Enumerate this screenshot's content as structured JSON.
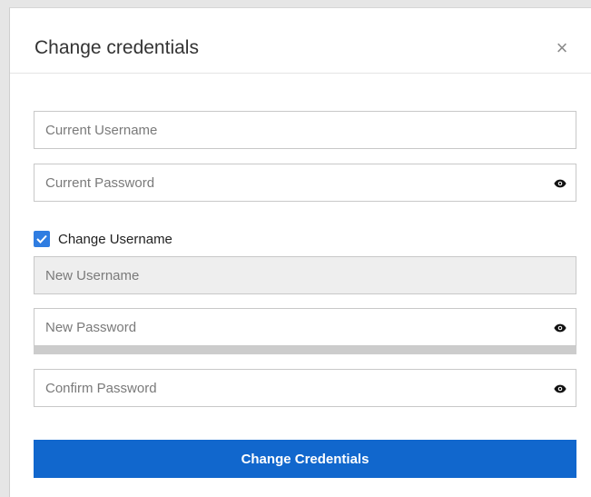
{
  "dialog": {
    "title": "Change credentials",
    "close_label": "×"
  },
  "fields": {
    "current_username": {
      "placeholder": "Current Username",
      "value": ""
    },
    "current_password": {
      "placeholder": "Current Password",
      "value": ""
    },
    "new_username": {
      "placeholder": "New Username",
      "value": "",
      "disabled": true
    },
    "new_password": {
      "placeholder": "New Password",
      "value": ""
    },
    "confirm_password": {
      "placeholder": "Confirm Password",
      "value": ""
    }
  },
  "change_username": {
    "label": "Change Username",
    "checked": true
  },
  "icons": {
    "password_toggle": "eye-icon",
    "checkbox": "checkmark-icon",
    "close": "close-icon"
  },
  "colors": {
    "primary_button": "#1167cd",
    "checkbox": "#2f7de1",
    "disabled_field": "#eeeeee",
    "strength_bar": "#cccccc"
  },
  "password_strength": {
    "level": 0
  },
  "submit": {
    "label": "Change Credentials"
  }
}
